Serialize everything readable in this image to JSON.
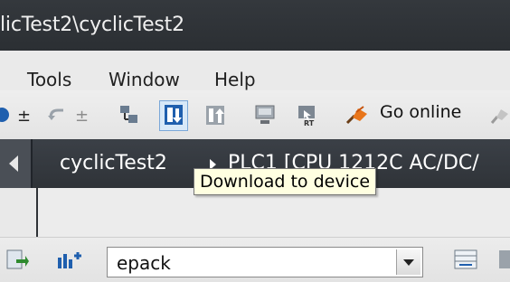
{
  "window": {
    "title": "licTest2\\cyclicTest2"
  },
  "menu": {
    "items": [
      "Tools",
      "Window",
      "Help"
    ]
  },
  "toolbar": {
    "go_online_label": "Go online",
    "icons": [
      "blue-circle-icon",
      "compile-icon",
      "undo-icon",
      "redo-icon",
      "network-view-icon",
      "download-to-device-icon",
      "upload-from-device-icon",
      "simulation-icon",
      "runtime-icon",
      "go-online-icon",
      "go-offline-icon"
    ]
  },
  "breadcrumb": {
    "item1": "cyclicTest2",
    "item2": "PLC1 [CPU 1212C AC/DC/"
  },
  "tooltip": {
    "text": "Download to device"
  },
  "panel": {
    "combo_value": "epack"
  },
  "colors": {
    "titlebar": "#2b2f33",
    "navbar": "#30343a",
    "tooltip_bg": "#ffffe1",
    "accent_blue": "#1f5fae",
    "accent_orange": "#e8751a"
  }
}
